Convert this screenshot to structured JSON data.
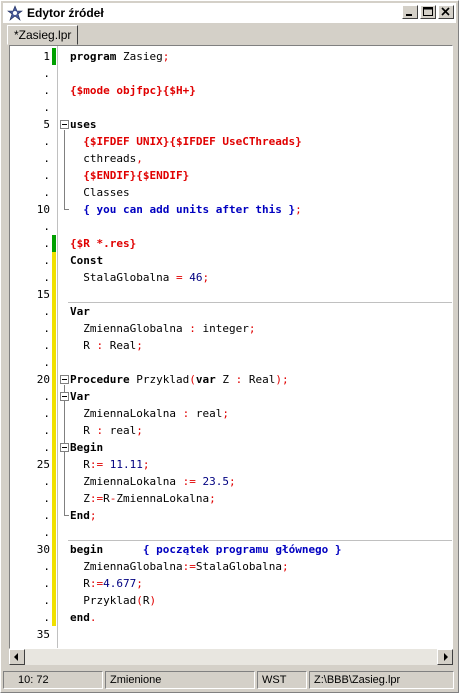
{
  "window": {
    "title": "Edytor źródeł",
    "controls": [
      "minimize-icon",
      "maximize-icon",
      "close-icon"
    ]
  },
  "tabs": [
    {
      "label": "*Zasieg.lpr",
      "active": true
    }
  ],
  "gutter": {
    "labels": [
      "1",
      ".",
      ".",
      ".",
      "5",
      ".",
      ".",
      ".",
      ".",
      "10",
      ".",
      ".",
      ".",
      ".",
      "15",
      ".",
      ".",
      ".",
      ".",
      "20",
      ".",
      ".",
      ".",
      ".",
      "25",
      ".",
      ".",
      ".",
      ".",
      "30",
      ".",
      ".",
      ".",
      ".",
      "35"
    ],
    "saved_color": "#00a000",
    "modified_color": "#f0e000"
  },
  "code": {
    "lines": [
      "program Zasieg;",
      "",
      "{$mode objfpc}{$H+}",
      "",
      "uses",
      "  {$IFDEF UNIX}{$IFDEF UseCThreads}",
      "  cthreads,",
      "  {$ENDIF}{$ENDIF}",
      "  Classes",
      "  { you can add units after this };",
      "",
      "{$R *.res}",
      "Const",
      "  StalaGlobalna = 46;",
      "",
      "Var",
      "  ZmiennaGlobalna : integer;",
      "  R : Real;",
      "",
      "Procedure Przyklad(var Z : Real);",
      "Var",
      "  ZmiennaLokalna : real;",
      "  R : real;",
      "Begin",
      "  R:= 11.11;",
      "  ZmiennaLokalna := 23.5;",
      "  Z:=R-ZmiennaLokalna;",
      "End;",
      "",
      "begin      { początek programu głównego }",
      "  ZmiennaGlobalna:=StalaGlobalna;",
      "  R:=4.677;",
      "  Przyklad(R)",
      "end.",
      ""
    ]
  },
  "statusbar": {
    "position": "10: 72",
    "state": "Zmienione",
    "mode": "WST",
    "path": "Z:\\BBB\\Zasieg.lpr"
  }
}
